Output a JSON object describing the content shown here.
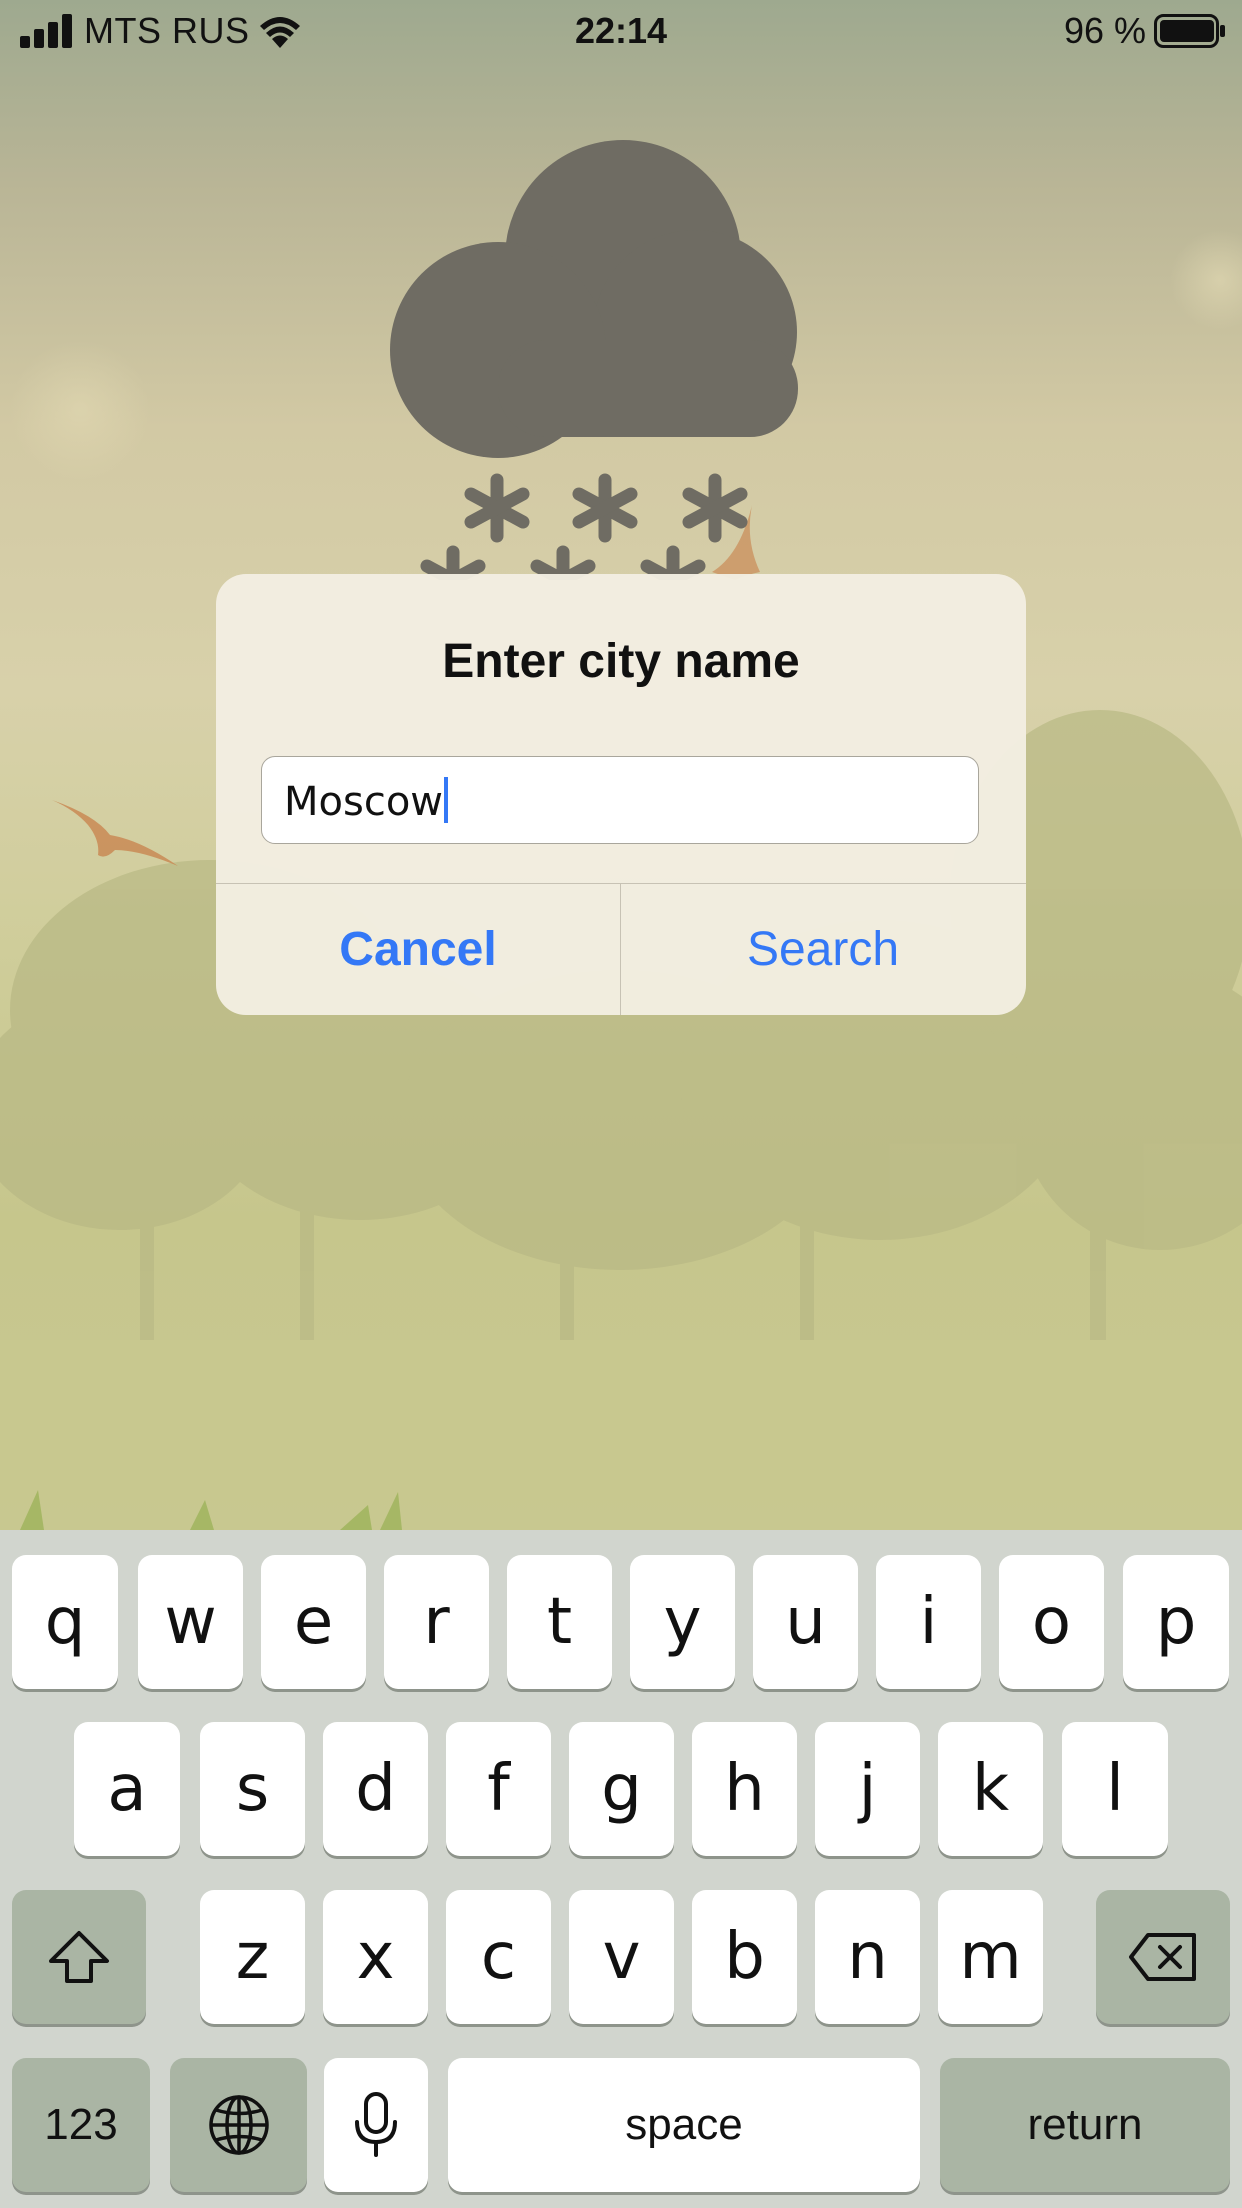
{
  "status_bar": {
    "carrier": "MTS RUS",
    "time": "22:14",
    "battery_percent": "96 %"
  },
  "weather": {
    "icon": "cloud-snow-icon",
    "cloud_color": "#6f6c63"
  },
  "alert": {
    "title": "Enter city name",
    "input_value": "Moscow",
    "cancel_label": "Cancel",
    "search_label": "Search",
    "accent_color": "#3478f6"
  },
  "keyboard": {
    "row1": [
      "q",
      "w",
      "e",
      "r",
      "t",
      "y",
      "u",
      "i",
      "o",
      "p"
    ],
    "row2": [
      "a",
      "s",
      "d",
      "f",
      "g",
      "h",
      "j",
      "k",
      "l"
    ],
    "row3": [
      "z",
      "x",
      "c",
      "v",
      "b",
      "n",
      "m"
    ],
    "numbers_label": "123",
    "space_label": "space",
    "return_label": "return"
  }
}
